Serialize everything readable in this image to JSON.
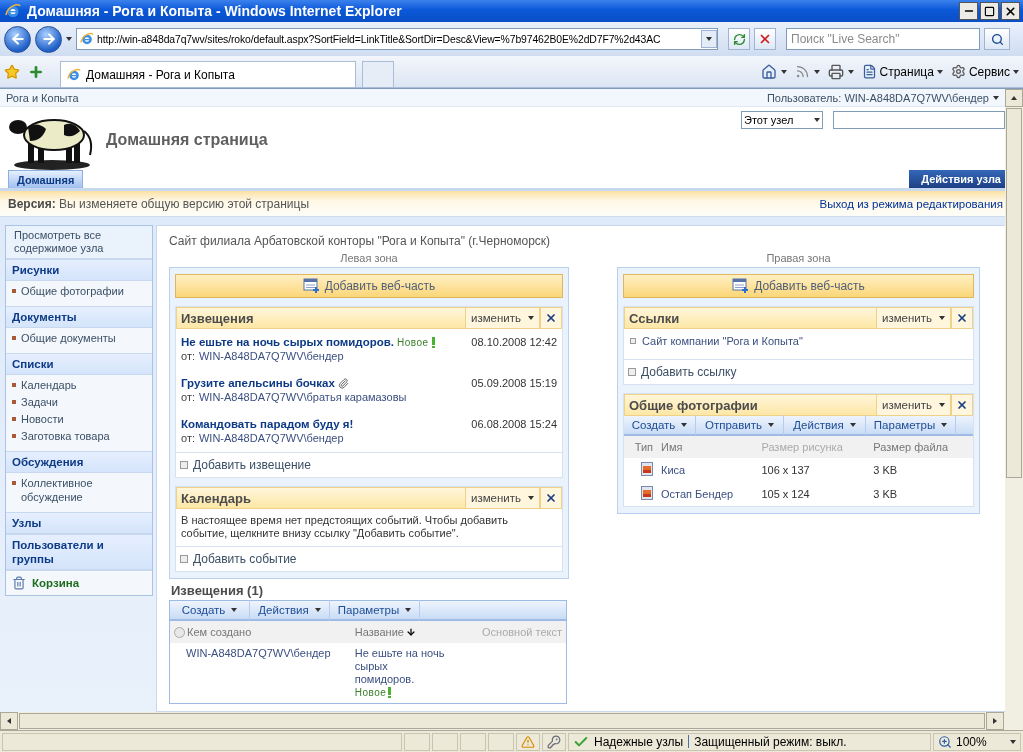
{
  "window": {
    "title": "Домашняя - Рога и Копыта - Windows Internet Explorer"
  },
  "address_bar": {
    "url": "http://win-a848da7q7wv/sites/roko/default.aspx?SortField=LinkTitle&SortDir=Desc&View=%7b97462B0E%2dD7F7%2d43AC",
    "search_placeholder": "Поиск \"Live Search\""
  },
  "tabs": [
    {
      "label": "Домашняя - Рога и Копыта",
      "selected": true
    }
  ],
  "command_bar": [
    "Страница",
    "Сервис"
  ],
  "site": {
    "breadcrumb": "Рога и Копыта",
    "user": "Пользователь: WIN-A848DA7Q7WV\\бендер",
    "title": "Домашняя страница",
    "scope": "Этот узел"
  },
  "top_nav": [
    {
      "label": "Домашняя",
      "selected": true
    }
  ],
  "site_actions": "Действия узла",
  "version_bar": {
    "text": "**Версия:** Вы изменяете общую версию этой страницы",
    "exit": "Выход из режима редактирования"
  },
  "quick_launch": {
    "view_all": "Просмотреть все содержимое узла",
    "sections": [
      {
        "title": "Рисунки",
        "items": [
          "Общие фотографии"
        ]
      },
      {
        "title": "Документы",
        "items": [
          "Общие документы"
        ]
      },
      {
        "title": "Списки",
        "items": [
          "Календарь",
          "Задачи",
          "Новости",
          "Заготовка товара"
        ]
      },
      {
        "title": "Обсуждения",
        "items": [
          "Коллективное обсуждение"
        ]
      },
      {
        "title": "Узлы"
      },
      {
        "title": "Пользователи и группы"
      }
    ],
    "recycle_bin": "Корзина"
  },
  "description": "Сайт филиала Арбатовской конторы \"Рога и Копыта\" (г.Черноморск)",
  "zones": [
    {
      "label": "Левая зона",
      "add_button": "Добавить веб-часть",
      "parts": [
        {
          "kind": "announcements",
          "title": "Извещения",
          "edit": "изменить",
          "items": [
            {
              "title": "Не ешьте на ночь сырых помидоров.",
              "badge": "Новое",
              "attachment": false,
              "date": "08.10.2008 12:42",
              "from": "от:",
              "author": "WIN-A848DA7Q7WV\\бендер"
            },
            {
              "title": "Грузите апельсины бочках",
              "attachment": true,
              "date": "05.09.2008 15:19",
              "from": "от:",
              "author": "WIN-A848DA7Q7WV\\братья карамазовы"
            },
            {
              "title": "Командовать парадом буду я!",
              "attachment": false,
              "date": "06.08.2008 15:24",
              "from": "от:",
              "author": "WIN-A848DA7Q7WV\\бендер"
            }
          ],
          "add": "Добавить извещение"
        },
        {
          "kind": "calendar",
          "title": "Календарь",
          "edit": "изменить",
          "message": "В настоящее время нет предстоящих событий. Чтобы добавить событие, щелкните внизу ссылку \"Добавить событие\".",
          "add": "Добавить событие"
        }
      ]
    },
    {
      "label": "Правая зона",
      "add_button": "Добавить веб-часть",
      "parts": [
        {
          "kind": "links",
          "title": "Ссылки",
          "edit": "изменить",
          "items": [
            "Сайт компании \"Рога и Копыта\""
          ],
          "add": "Добавить ссылку"
        },
        {
          "kind": "library",
          "title": "Общие фотографии",
          "edit": "изменить",
          "toolbar": [
            "Создать",
            "Отправить",
            "Действия",
            "Параметры"
          ],
          "columns": [
            "Тип",
            "Имя",
            "Размер рисунка",
            "Размер файла"
          ],
          "rows": [
            {
              "name": "Киса",
              "dimensions": "106 x 137",
              "size": "3 KB"
            },
            {
              "name": "Остап Бендер",
              "dimensions": "105 x 124",
              "size": "3 KB"
            }
          ]
        }
      ]
    }
  ],
  "list_view": {
    "title": "Извещения (1)",
    "select_all_checked": false,
    "toolbar": [
      "Создать",
      "Действия",
      "Параметры"
    ],
    "columns": [
      {
        "label": "Кем создано",
        "sorted": false
      },
      {
        "label": "Название",
        "sorted": true
      },
      {
        "label": "Основной текст",
        "sorted": false
      }
    ],
    "rows": [
      {
        "author": "WIN-A848DA7Q7WV\\бендер",
        "title": "Не ешьте на ночь сырых помидоров.",
        "badge": "Новое"
      }
    ]
  },
  "status_bar": {
    "zone": "Надежные узлы",
    "mode": "Защищенный режим: выкл.",
    "zoom": "100%"
  }
}
